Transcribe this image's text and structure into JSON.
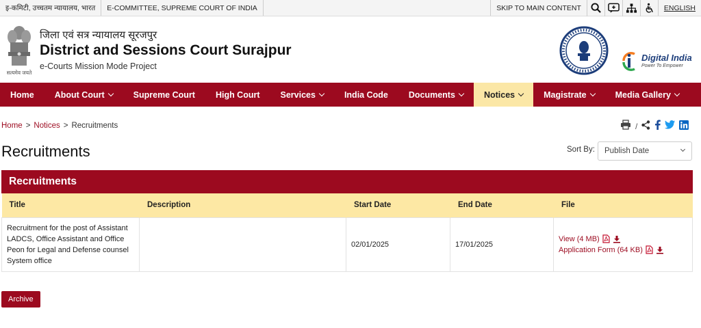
{
  "topbar": {
    "hindi_link": "इ-कमिटी, उच्चतम न्यायालय, भारत",
    "ecommittee_link": "E-COMMITTEE, SUPREME COURT OF INDIA",
    "skip_link": "SKIP TO MAIN CONTENT",
    "language": "ENGLISH"
  },
  "header": {
    "hindi_title": "जिला एवं सत्र न्यायालय सूरजपुर",
    "title": "District and Sessions Court Surajpur",
    "subtitle": "e-Courts Mission Mode Project",
    "emblem_motto": "सत्यमेव जयते",
    "digital_india": "Digital India",
    "digital_india_tagline": "Power To Empower"
  },
  "nav": {
    "items": [
      {
        "label": "Home",
        "dropdown": false
      },
      {
        "label": "About Court",
        "dropdown": true
      },
      {
        "label": "Supreme Court",
        "dropdown": false
      },
      {
        "label": "High Court",
        "dropdown": false
      },
      {
        "label": "Services",
        "dropdown": true
      },
      {
        "label": "India Code",
        "dropdown": false
      },
      {
        "label": "Documents",
        "dropdown": true
      },
      {
        "label": "Notices",
        "dropdown": true,
        "active": true
      },
      {
        "label": "Magistrate",
        "dropdown": true
      },
      {
        "label": "Media Gallery",
        "dropdown": true
      }
    ]
  },
  "breadcrumb": {
    "home": "Home",
    "notices": "Notices",
    "current": "Recruitments",
    "separator": ">"
  },
  "page": {
    "title": "Recruitments",
    "sort_label": "Sort By:",
    "sort_value": "Publish Date"
  },
  "table": {
    "heading": "Recruitments",
    "columns": [
      "Title",
      "Description",
      "Start Date",
      "End Date",
      "File"
    ],
    "rows": [
      {
        "title": "Recruitment for the post of Assistant LADCS, Office Assistant and Office Peon for Legal and Defense counsel System office",
        "description": "",
        "start_date": "02/01/2025",
        "end_date": "17/01/2025",
        "files": [
          "View (4 MB)",
          "Application Form (64 KB)"
        ]
      }
    ]
  },
  "archive_label": "Archive",
  "colors": {
    "brand": "#9c0a1f",
    "header_row": "#fde8a4",
    "active_nav": "#fbe7a6"
  }
}
